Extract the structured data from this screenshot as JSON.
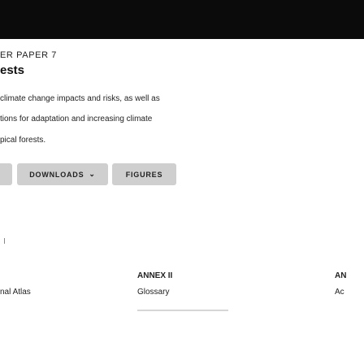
{
  "header": {
    "paper_label": "ER PAPER 7",
    "title": "ests"
  },
  "description": {
    "line1": "climate change impacts and risks, as well as",
    "line2": "tions for adaptation and increasing climate",
    "line3": "pical forests."
  },
  "buttons": {
    "downloads_label": "DOWNLOADS",
    "downloads_chevron": "⌄",
    "figures_label": "FIGURES"
  },
  "links": [
    {
      "title": "",
      "subtitle": "nal Atlas"
    },
    {
      "title": "ANNEX II",
      "subtitle": "Glossary"
    },
    {
      "title": "AN",
      "subtitle": "Ac"
    }
  ],
  "colors": {
    "banner": "#0b0b0b",
    "button_bg": "#cfcfcf"
  }
}
